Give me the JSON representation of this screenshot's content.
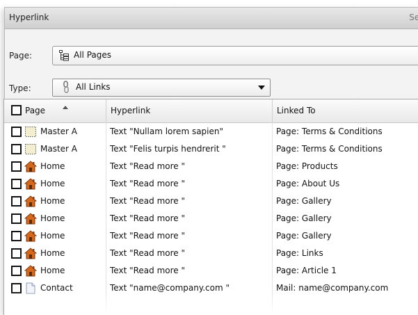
{
  "titlebar": {
    "title": "Hyperlink",
    "right_text": "Set"
  },
  "page_filter": {
    "label": "Page:",
    "value": "All Pages",
    "icon": "page-tree-icon"
  },
  "type_filter": {
    "label": "Type:",
    "value": "All Links",
    "icon": "chain-link-icon"
  },
  "table": {
    "columns": [
      "Page",
      "Hyperlink",
      "Linked To"
    ],
    "rows": [
      {
        "page": "Master A",
        "icon": "master-page-icon",
        "hyperlink": "Text \"Nullam lorem sapien\"",
        "linked_to": "Page: Terms & Conditions"
      },
      {
        "page": "Master A",
        "icon": "master-page-icon",
        "hyperlink": "Text \"Felis turpis hendrerit \"",
        "linked_to": "Page: Terms & Conditions"
      },
      {
        "page": "Home",
        "icon": "home-icon",
        "hyperlink": "Text \"Read more \"",
        "linked_to": "Page: Products"
      },
      {
        "page": "Home",
        "icon": "home-icon",
        "hyperlink": "Text \"Read more \"",
        "linked_to": "Page: About Us"
      },
      {
        "page": "Home",
        "icon": "home-icon",
        "hyperlink": "Text \"Read more \"",
        "linked_to": "Page: Gallery"
      },
      {
        "page": "Home",
        "icon": "home-icon",
        "hyperlink": "Text \"Read more \"",
        "linked_to": "Page: Gallery"
      },
      {
        "page": "Home",
        "icon": "home-icon",
        "hyperlink": "Text \"Read more \"",
        "linked_to": "Page: Gallery"
      },
      {
        "page": "Home",
        "icon": "home-icon",
        "hyperlink": "Text \"Read more \"",
        "linked_to": "Page: Links"
      },
      {
        "page": "Home",
        "icon": "home-icon",
        "hyperlink": "Text \"Read more \"",
        "linked_to": "Page: Article 1"
      },
      {
        "page": "Contact",
        "icon": "document-page-icon",
        "hyperlink": "Text \"name@company.com \"",
        "linked_to": "Mail: name@company.com"
      }
    ]
  }
}
